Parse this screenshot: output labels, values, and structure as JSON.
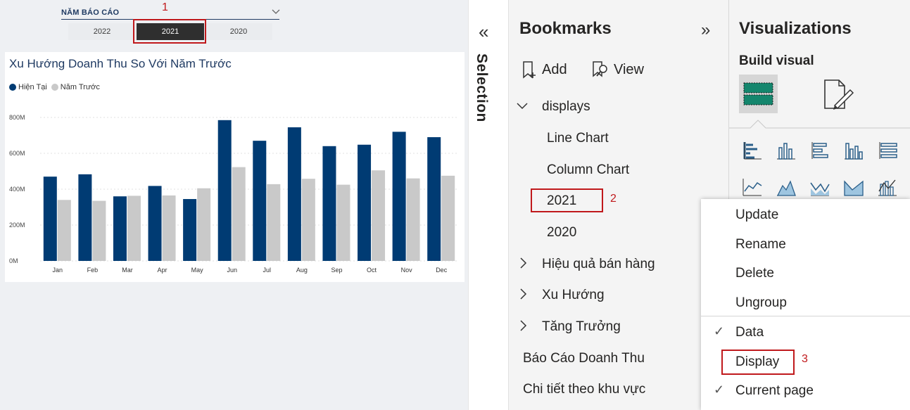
{
  "slicer": {
    "title": "NĂM BÁO CÁO",
    "years": [
      "2022",
      "2021",
      "2020"
    ],
    "selected": "2021"
  },
  "annotations": {
    "n1": "1",
    "n2": "2",
    "n3": "3"
  },
  "chart_data": {
    "type": "bar",
    "title": "Xu Hướng Doanh Thu So Với Năm Trước",
    "categories": [
      "Jan",
      "Feb",
      "Mar",
      "Apr",
      "May",
      "Jun",
      "Jul",
      "Aug",
      "Sep",
      "Oct",
      "Nov",
      "Dec"
    ],
    "series": [
      {
        "name": "Hiện Tại",
        "color": "#003b73",
        "values": [
          470,
          483,
          360,
          418,
          345,
          785,
          670,
          745,
          640,
          648,
          720,
          690
        ]
      },
      {
        "name": "Năm Trước",
        "color": "#c9c9c9",
        "values": [
          340,
          335,
          363,
          365,
          405,
          523,
          428,
          458,
          425,
          505,
          460,
          475
        ]
      }
    ],
    "yticks": [
      "0M",
      "200M",
      "400M",
      "600M",
      "800M"
    ],
    "ylim": [
      0,
      800
    ],
    "grid": true,
    "legend": "top-left"
  },
  "selection": {
    "label": "Selection"
  },
  "bookmarks": {
    "title": "Bookmarks",
    "add_label": "Add",
    "view_label": "View",
    "groups": {
      "displays": "displays",
      "line_chart": "Line Chart",
      "column_chart": "Column Chart",
      "b2021": "2021",
      "b2020": "2020",
      "hieu_qua": "Hiệu quả bán hàng",
      "xu_huong": "Xu Hướng",
      "tang_truong": "Tăng Trưởng",
      "bao_cao": "Báo Cáo Doanh Thu",
      "chi_tiet": "Chi tiết theo khu vực"
    }
  },
  "visualizations": {
    "title": "Visualizations",
    "build_visual": "Build visual"
  },
  "context_menu": {
    "update": "Update",
    "rename": "Rename",
    "delete": "Delete",
    "ungroup": "Ungroup",
    "data": "Data",
    "display": "Display",
    "current_page": "Current page"
  }
}
